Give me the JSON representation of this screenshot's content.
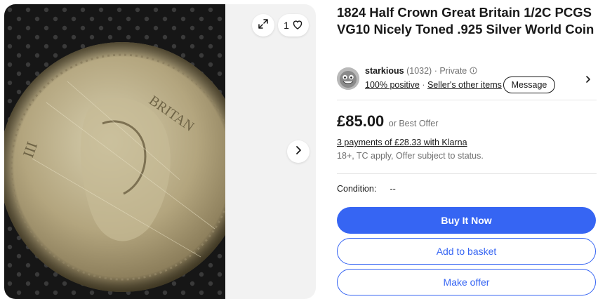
{
  "listing": {
    "title": "1824 Half Crown Great Britain 1/2C PCGS VG10 Nicely Toned .925 Silver World Coin"
  },
  "gallery": {
    "watch_count": "1",
    "icons": {
      "expand": "expand-icon",
      "watch": "heart-icon",
      "next": "chevron-right-icon"
    }
  },
  "seller": {
    "name": "starkious",
    "feedback_count": "(1032)",
    "seller_type": "· Private",
    "positive": "100% positive",
    "separator": "·",
    "other_items": "Seller's other items",
    "message_label": "Message"
  },
  "price": {
    "amount": "£85.00",
    "offer": "or Best Offer",
    "klarna": "3 payments of £28.33 with Klarna",
    "terms": "18+, TC apply, Offer subject to status."
  },
  "condition": {
    "label": "Condition:",
    "value": "--"
  },
  "actions": {
    "buy_now": "Buy It Now",
    "add_to_basket": "Add to basket",
    "make_offer": "Make offer"
  },
  "colors": {
    "primary": "#3665f3",
    "text": "#191919",
    "muted": "#707070"
  }
}
